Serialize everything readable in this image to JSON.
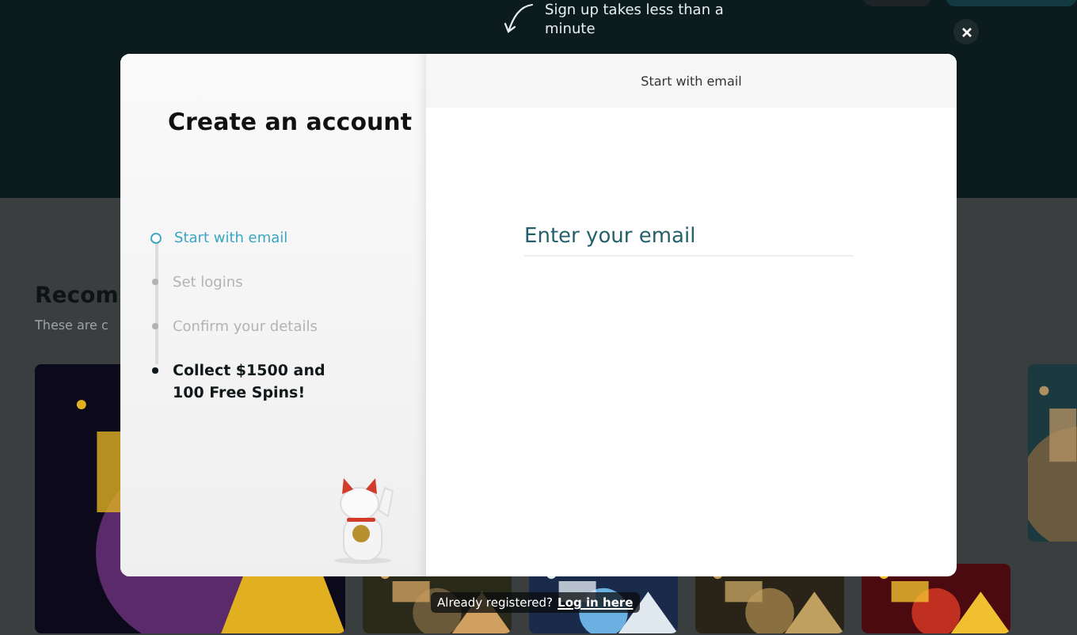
{
  "hint": {
    "text": "Sign up takes less than a minute"
  },
  "background": {
    "heading": "Recom",
    "subtitle": "These are c"
  },
  "modal": {
    "title": "Create an account",
    "steps": [
      {
        "label": "Start with email",
        "kind": "step",
        "selected": true
      },
      {
        "label": "Set logins",
        "kind": "step",
        "selected": false
      },
      {
        "label": "Confirm your details",
        "kind": "step",
        "selected": false
      },
      {
        "label": "Collect $1500 and 100 Free Spins!",
        "kind": "reward",
        "selected": false
      }
    ],
    "tab": "Start with email",
    "email": {
      "placeholder": "Enter your email"
    }
  },
  "footer": {
    "text": "Already registered?",
    "link": "Log in here"
  }
}
